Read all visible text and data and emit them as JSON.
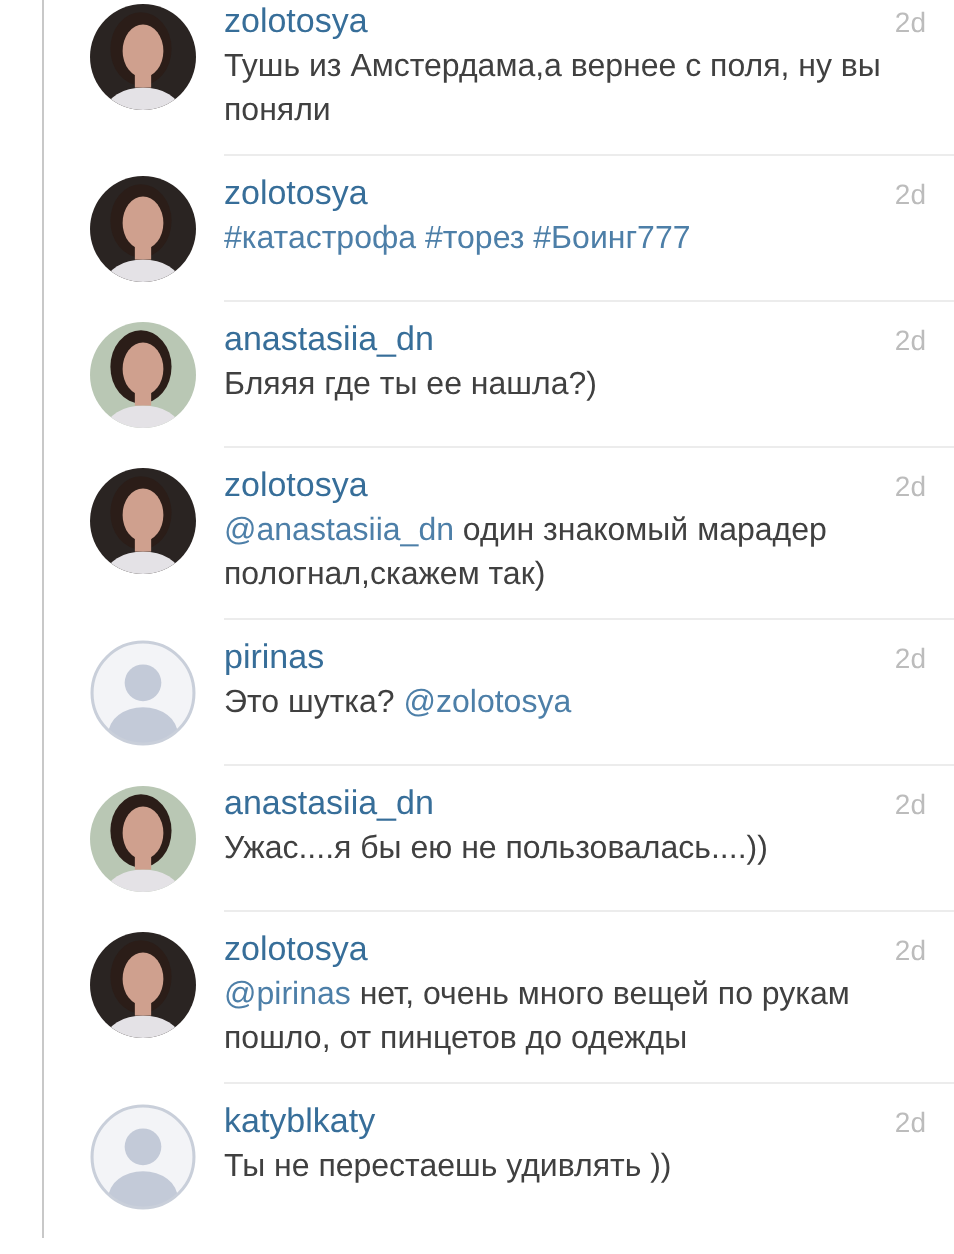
{
  "comments": [
    {
      "user": "zolotosya",
      "color": "#2a2422",
      "time": "2d",
      "parts": [
        {
          "text": "Тушь из Амстердама,а вернее с поля, ну вы поняли",
          "link": false
        }
      ]
    },
    {
      "user": "zolotosya",
      "color": "#2a2422",
      "time": "2d",
      "parts": [
        {
          "text": "#катастрофа",
          "link": true
        },
        {
          "text": " #торез",
          "link": true
        },
        {
          "text": " #Боинг777",
          "link": true
        }
      ]
    },
    {
      "user": "anastasiia_dn",
      "color": "#b9c7b4",
      "time": "2d",
      "parts": [
        {
          "text": "Бляяя где ты ее нашла?)",
          "link": false
        }
      ]
    },
    {
      "user": "zolotosya",
      "color": "#2a2422",
      "time": "2d",
      "parts": [
        {
          "text": "@anastasiia_dn",
          "link": true
        },
        {
          "text": " один знакомый марадер пологнал,скажем так)",
          "link": false
        }
      ]
    },
    {
      "user": "pirinas",
      "kind": "placeholder",
      "time": "2d",
      "parts": [
        {
          "text": "Это шутка? ",
          "link": false
        },
        {
          "text": "@zolotosya",
          "link": true
        }
      ]
    },
    {
      "user": "anastasiia_dn",
      "color": "#b9c7b4",
      "time": "2d",
      "parts": [
        {
          "text": "Ужас....я бы ею не пользовалась....))",
          "link": false
        }
      ]
    },
    {
      "user": "zolotosya",
      "color": "#2a2422",
      "time": "2d",
      "parts": [
        {
          "text": "@pirinas",
          "link": true
        },
        {
          "text": " нет, очень много вещей по рукам пошло, от пинцетов до одежды",
          "link": false
        }
      ]
    },
    {
      "user": "katyblkaty",
      "kind": "placeholder",
      "time": "2d",
      "parts": [
        {
          "text": "Ты не перестаешь удивлять ))",
          "link": false
        }
      ]
    }
  ]
}
